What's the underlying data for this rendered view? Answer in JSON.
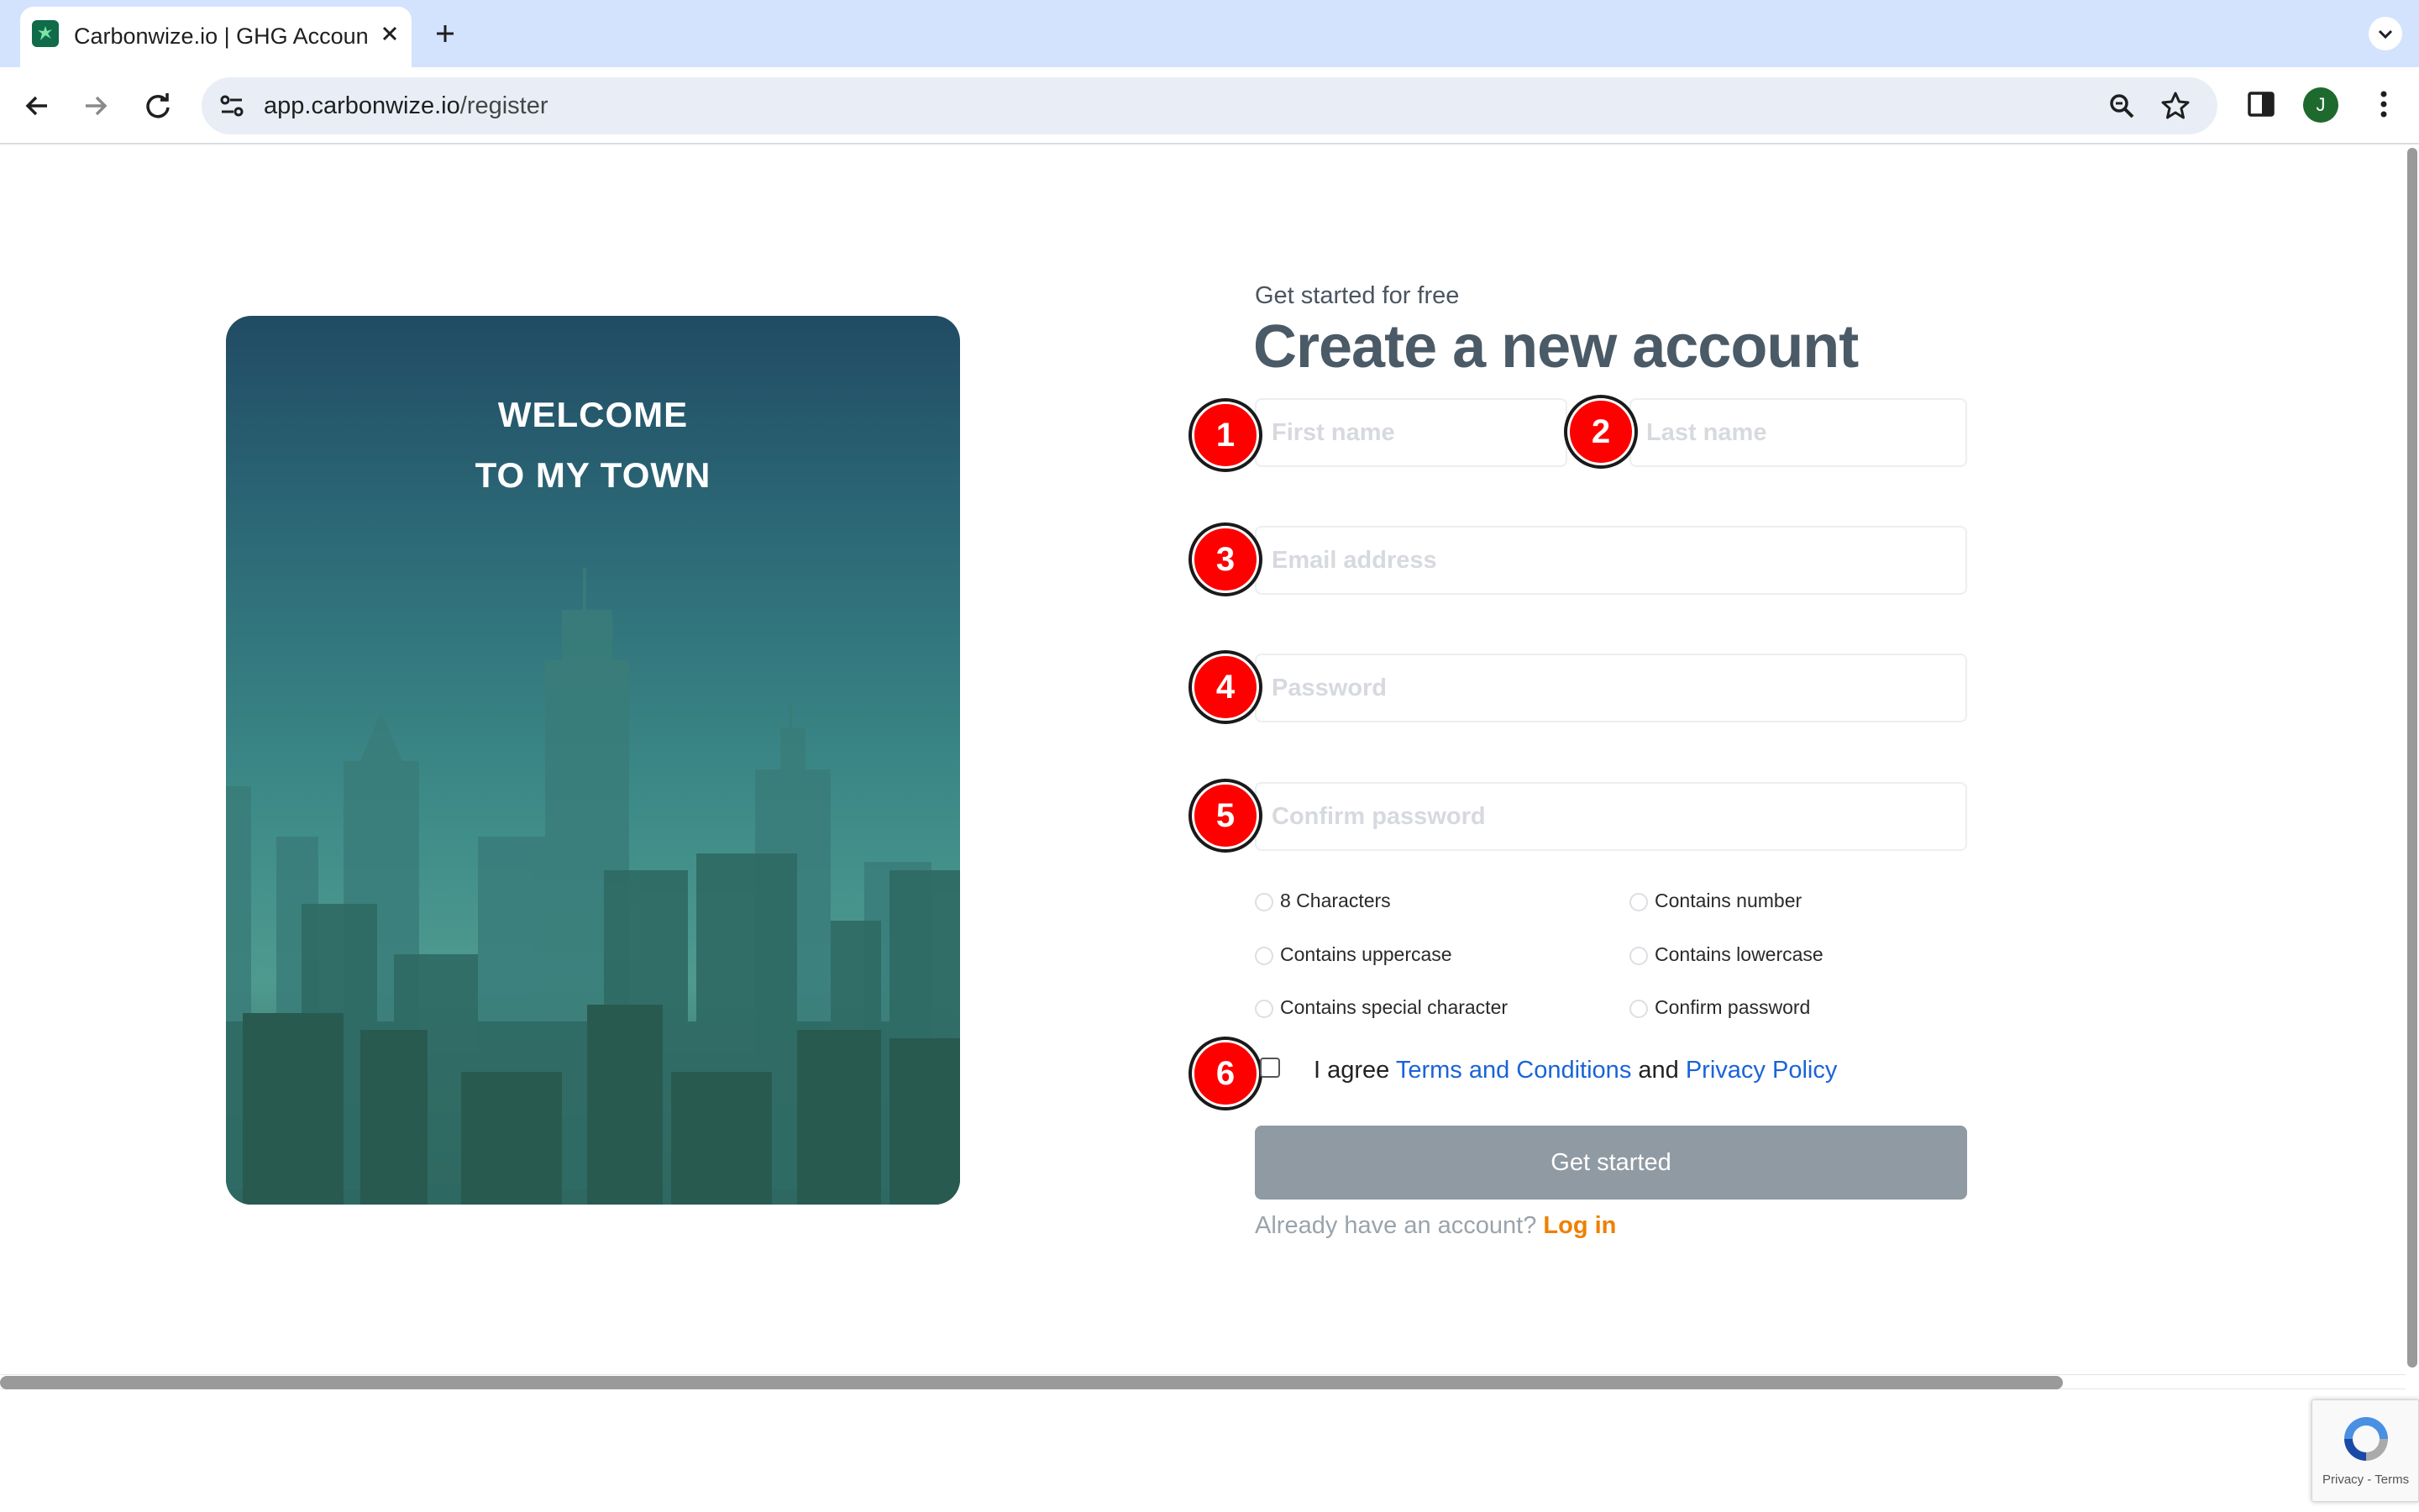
{
  "browser": {
    "tab_title": "Carbonwize.io | GHG Accoun",
    "url_host": "app.carbonwize.io",
    "url_path": "/register",
    "avatar_initial": "J"
  },
  "page": {
    "hero": {
      "line1": "WELCOME",
      "line2": "TO MY TOWN"
    },
    "subtitle": "Get started for free",
    "heading": "Create a new account",
    "fields": {
      "first_name": {
        "placeholder": "First name",
        "value": ""
      },
      "last_name": {
        "placeholder": "Last name",
        "value": ""
      },
      "email": {
        "placeholder": "Email address",
        "value": ""
      },
      "password": {
        "placeholder": "Password",
        "value": ""
      },
      "confirm_password": {
        "placeholder": "Confirm password",
        "value": ""
      }
    },
    "markers": [
      "1",
      "2",
      "3",
      "4",
      "5",
      "6"
    ],
    "requirements": [
      "8 Characters",
      "Contains number",
      "Contains uppercase",
      "Contains lowercase",
      "Contains special character",
      "Confirm password"
    ],
    "agree": {
      "prefix": "I agree",
      "terms": "Terms and Conditions",
      "and": "and",
      "privacy": "Privacy Policy",
      "checked": false
    },
    "submit_label": "Get started",
    "login_prompt": "Already have an account?",
    "login_link": "Log in",
    "recaptcha_text": "Privacy - Terms"
  },
  "colors": {
    "accent_link": "#1a63d8",
    "login_orange": "#f07f00",
    "marker_red": "#ff0000",
    "button_disabled": "#8f9aa3"
  }
}
